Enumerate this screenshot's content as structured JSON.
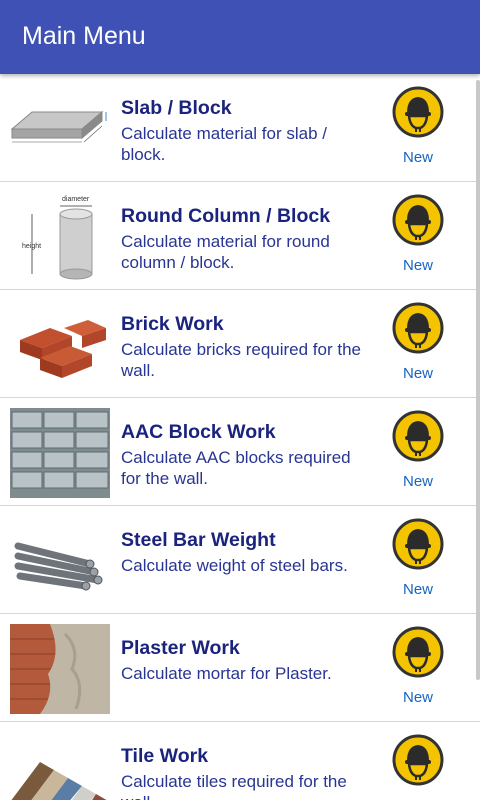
{
  "appbar": {
    "title": "Main Menu"
  },
  "menu": {
    "new_label": "New",
    "items": [
      {
        "title": "Slab / Block",
        "desc": "Calculate material for slab / block."
      },
      {
        "title": "Round Column / Block",
        "desc": "Calculate material for round column / block.",
        "image_labels": [
          "diameter",
          "height"
        ]
      },
      {
        "title": "Brick Work",
        "desc": "Calculate bricks required for the wall."
      },
      {
        "title": "AAC Block Work",
        "desc": "Calculate AAC blocks required for the wall."
      },
      {
        "title": "Steel Bar Weight",
        "desc": "Calculate weight of steel bars."
      },
      {
        "title": "Plaster Work",
        "desc": "Calculate mortar for Plaster."
      },
      {
        "title": "Tile Work",
        "desc": "Calculate tiles required for the wall."
      }
    ]
  },
  "colors": {
    "appbar": "#3f51b5",
    "title_text": "#1a237e",
    "desc_text": "#283593",
    "new_text": "#1565c0",
    "badge_yellow": "#f5c400"
  },
  "icons": {
    "badge": "hard-hat-worker-icon"
  }
}
